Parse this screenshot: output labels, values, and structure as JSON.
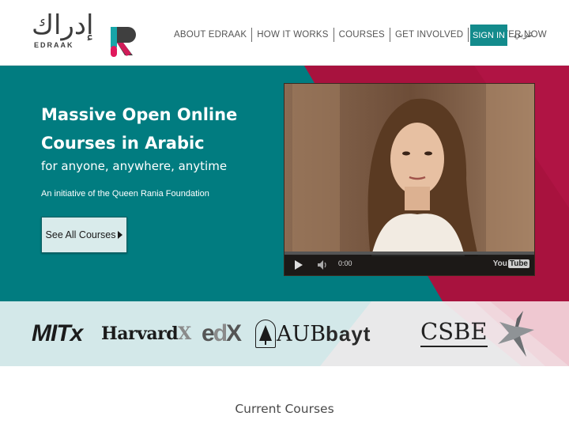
{
  "header": {
    "logo": {
      "arabic": "إدراك",
      "latin": "EDRAAK",
      "mark": "edraak-logo-mark"
    },
    "nav": [
      {
        "label": "ABOUT EDRAAK"
      },
      {
        "label": "HOW IT WORKS"
      },
      {
        "label": "COURSES"
      },
      {
        "label": "GET INVOLVED"
      },
      {
        "label": "REGISTER NOW"
      }
    ],
    "signin_label": "SIGN IN",
    "language_label": "عربي"
  },
  "hero": {
    "title": "Massive Open Online Courses in Arabic",
    "subtitle": "for anyone, anywhere, anytime",
    "initiative": "An initiative of the Queen Rania Foundation",
    "cta_label": "See All Courses",
    "colors": {
      "teal": "#017c80",
      "crimson": "#a8123e",
      "pink": "#cf1a52"
    }
  },
  "video": {
    "time": "0:00",
    "brand": "YouTube",
    "icons": [
      "play-icon",
      "volume-icon",
      "youtube-logo"
    ]
  },
  "partners": {
    "items": [
      {
        "name": "MITx"
      },
      {
        "name": "HarvardX"
      },
      {
        "name": "edX"
      },
      {
        "name": "AUB"
      },
      {
        "name": "bayt"
      },
      {
        "name": "CSBE"
      },
      {
        "name": "star-logo"
      }
    ]
  },
  "courses": {
    "title": "Current Courses"
  }
}
